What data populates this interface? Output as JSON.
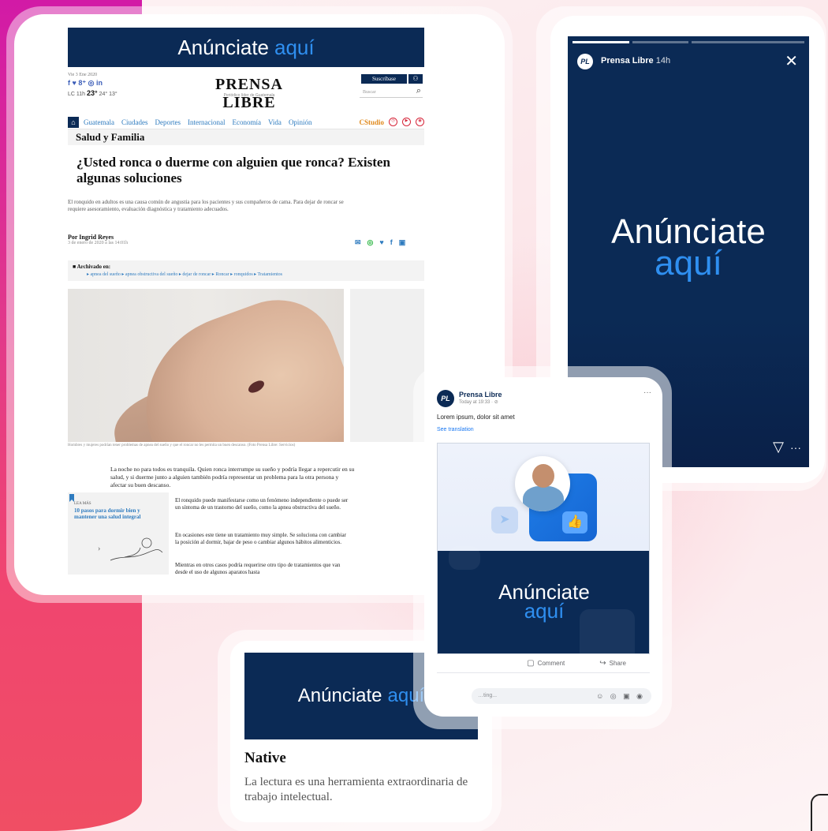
{
  "ad_label": {
    "main": "Anúnciate",
    "accent": "aquí"
  },
  "desktop": {
    "date": "Vie 3 Ene 2020",
    "social": "f ♥ 8⁺ ◎ in",
    "weather_city": "LC 11h",
    "weather_temp": "23°",
    "weather_extra": "24° 13°",
    "logo": "PRENSA LIBRE",
    "logo_tagline": "Periódico líder de Guatemala",
    "subscribe": "Suscríbase",
    "search_placeholder": "Buscar",
    "nav": [
      "Guatemala",
      "Ciudades",
      "Deportes",
      "Internacional",
      "Economía",
      "Vida",
      "Opinión"
    ],
    "studio": "CStudio",
    "section": "Salud y Familia",
    "headline": "¿Usted ronca o duerme con alguien que ronca? Existen algunas soluciones",
    "lede": "El ronquido en adultos es una causa común de angustia para los pacientes y sus compañeros de cama. Para dejar de roncar se requiere asesoramiento, evaluación diagnóstica y tratamiento adecuados.",
    "author": "Por Ingrid Reyes",
    "pub_date": "3 de enero de 2020 a las 14:01h",
    "archive_label": "Archivado en:",
    "tags": "▸ apnea del sueño  ▸ apnea obstructiva del sueño  ▸ dejar de roncar  ▸ Roncar  ▸ ronquidos  ▸ Tratamientos",
    "photo_caption": "Hombres y mujeres podrían tener problemas de apnea del sueño y que el roncar no les permita un buen descanso. (Foto Prensa Libre: Servicios)",
    "para1": "La noche no para todos es tranquila.  Quien ronca interrumpe su sueño y podría llegar a repercutir en su salud, y si duerme junto a alguien también podría representar un problema para la otra persona y afectar su buen descanso.",
    "read_more_label": "LEA MÁS",
    "read_more_title": "10 pasos para dormir bien y mantener una salud integral",
    "read_more_arrow": "›",
    "para2": "El ronquido puede manifestarse como un fenómeno independiente o puede ser un síntoma de un trastorno del sueño, como la apnea obstructiva del sueño.",
    "para3": "En ocasiones este tiene un tratamiento muy simple.  Se soluciona con cambiar la posición al dormir, bajar de peso o cambiar algunos hábitos alimenticios.",
    "para4": "Mientras en otros casos podría requerirse otro tipo de tratamientos que van desde el uso de algunos aparatos hasta"
  },
  "story": {
    "avatar": "PL",
    "name": "Prensa Libre",
    "time": "14h",
    "close": "✕",
    "send": "▽",
    "more": "···"
  },
  "facebook": {
    "avatar": "PL",
    "name": "Prensa Libre",
    "time": "Today at 19:33 · ⊘",
    "more": "···",
    "text": "Lorem ipsum, dolor sit amet",
    "translate": "See translation",
    "comment_label": "Comment",
    "share_label": "Share",
    "comment_placeholder": "…ting...",
    "comment_icons": "☺ ◎ ▣ ◉"
  },
  "native": {
    "title": "Native",
    "description": "La lectura es una herramienta extraordinaria de trabajo intelectual."
  },
  "colors": {
    "navy": "#0b2a55",
    "accent_blue": "#2f8ff0",
    "magenta": "#d21aa6",
    "coral": "#f04e64"
  }
}
